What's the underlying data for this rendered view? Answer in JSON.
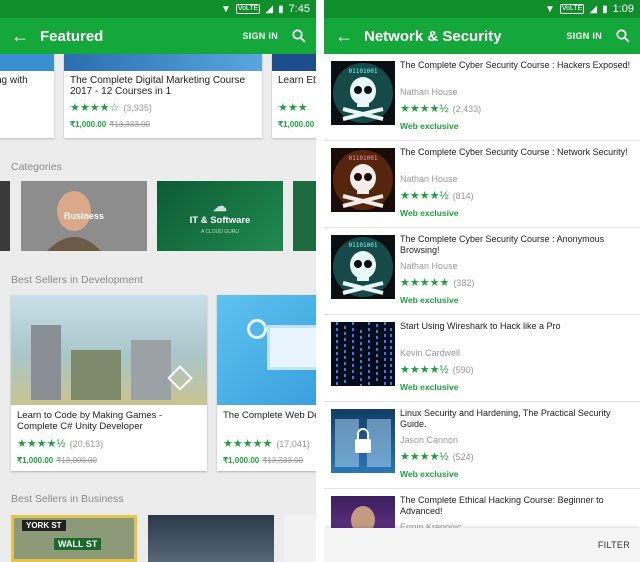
{
  "left": {
    "status": {
      "time": "7:45",
      "volte": "VoLTE"
    },
    "toolbar": {
      "title": "Featured",
      "signin": "SIGN IN"
    },
    "featured": [
      {
        "title": "ng with",
        "stars": "",
        "reviews": "",
        "price": "",
        "old_price": ""
      },
      {
        "title": "The Complete Digital Marketing Course 2017 - 12 Courses in 1",
        "stars": "★★★★☆",
        "reviews": "(3,935)",
        "price": "₹1,000.00",
        "old_price": "₹13,333.00"
      },
      {
        "title": "Learn Eth",
        "stars": "★★★",
        "reviews": "",
        "price": "₹1,000.00",
        "old_price": ""
      }
    ],
    "sections": {
      "categories": "Categories",
      "development": "Best Sellers in Development",
      "business": "Best Sellers in Business"
    },
    "categories": [
      {
        "label": "Business"
      },
      {
        "label": "IT & Software",
        "sub": "A CLOUD GURU"
      }
    ],
    "development": [
      {
        "title": "Learn to Code by Making Games - Complete C# Unity Developer",
        "stars": "★★★★½",
        "reviews": "(20,613)",
        "price": "₹1,000.00",
        "old_price": "₹13,000.00"
      },
      {
        "title": "The Complete Web Dev",
        "stars": "★★★★★",
        "reviews": "(17,041)",
        "price": "₹1,000.00",
        "old_price": "₹13,333.00"
      }
    ],
    "business_sign": {
      "street1": "YORK ST",
      "street2": "WALL ST"
    }
  },
  "right": {
    "status": {
      "time": "1:09",
      "volte": "VoLTE"
    },
    "toolbar": {
      "title": "Network & Security",
      "signin": "SIGN IN"
    },
    "courses": [
      {
        "title": "The Complete Cyber Security Course : Hackers Exposed!",
        "author": "Nathan House",
        "stars": "★★★★½",
        "reviews": "(2,433)",
        "badge": "Web exclusive"
      },
      {
        "title": "The Complete Cyber Security Course : Network Security!",
        "author": "Nathan House",
        "stars": "★★★★½",
        "reviews": "(814)",
        "badge": "Web exclusive"
      },
      {
        "title": "The Complete Cyber Security Course : Anonymous Browsing!",
        "author": "Nathan House",
        "stars": "★★★★★",
        "reviews": "(382)",
        "badge": "Web exclusive"
      },
      {
        "title": "Start Using Wireshark to Hack like a Pro",
        "author": "Kevin Cardwell",
        "stars": "★★★★½",
        "reviews": "(590)",
        "badge": "Web exclusive"
      },
      {
        "title": "Linux Security and Hardening, The Practical Security Guide.",
        "author": "Jason Cannon",
        "stars": "★★★★½",
        "reviews": "(524)",
        "badge": "Web exclusive"
      },
      {
        "title": "The Complete Ethical Hacking Course: Beginner to Advanced!",
        "author": "Ermin Kreponic",
        "stars": "",
        "reviews": "",
        "badge": ""
      }
    ],
    "filter": "FILTER",
    "thumb_text": "01101001"
  },
  "colors": {
    "toolbar": "#14a83a",
    "statusbar": "#0f8f2c",
    "accent": "#1e9e3c"
  }
}
